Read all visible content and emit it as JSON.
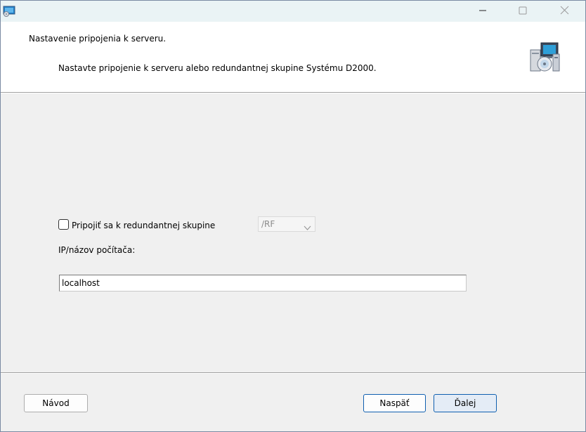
{
  "window": {
    "title": "",
    "controls": {
      "minimize": "minimize-icon",
      "maximize": "maximize-icon",
      "close": "close-icon"
    }
  },
  "header": {
    "title": "Nastavenie pripojenia k serveru.",
    "description": "Nastavte pripojenie k serveru alebo redundantnej skupine Systému D2000.",
    "graphic": "setup-computer-cd-icon"
  },
  "form": {
    "redundant_checkbox": {
      "label": "Pripojiť sa k redundantnej skupine",
      "checked": false
    },
    "group_select": {
      "value": "/RF",
      "disabled": true
    },
    "ip_label": "IP/názov počítača:",
    "ip_value": "localhost"
  },
  "footer": {
    "help_label": "Návod",
    "back_label": "Naspäť",
    "next_label": "Ďalej"
  },
  "colors": {
    "accent_border": "#0f5fb0",
    "titlebar": "#eaf3f5"
  }
}
